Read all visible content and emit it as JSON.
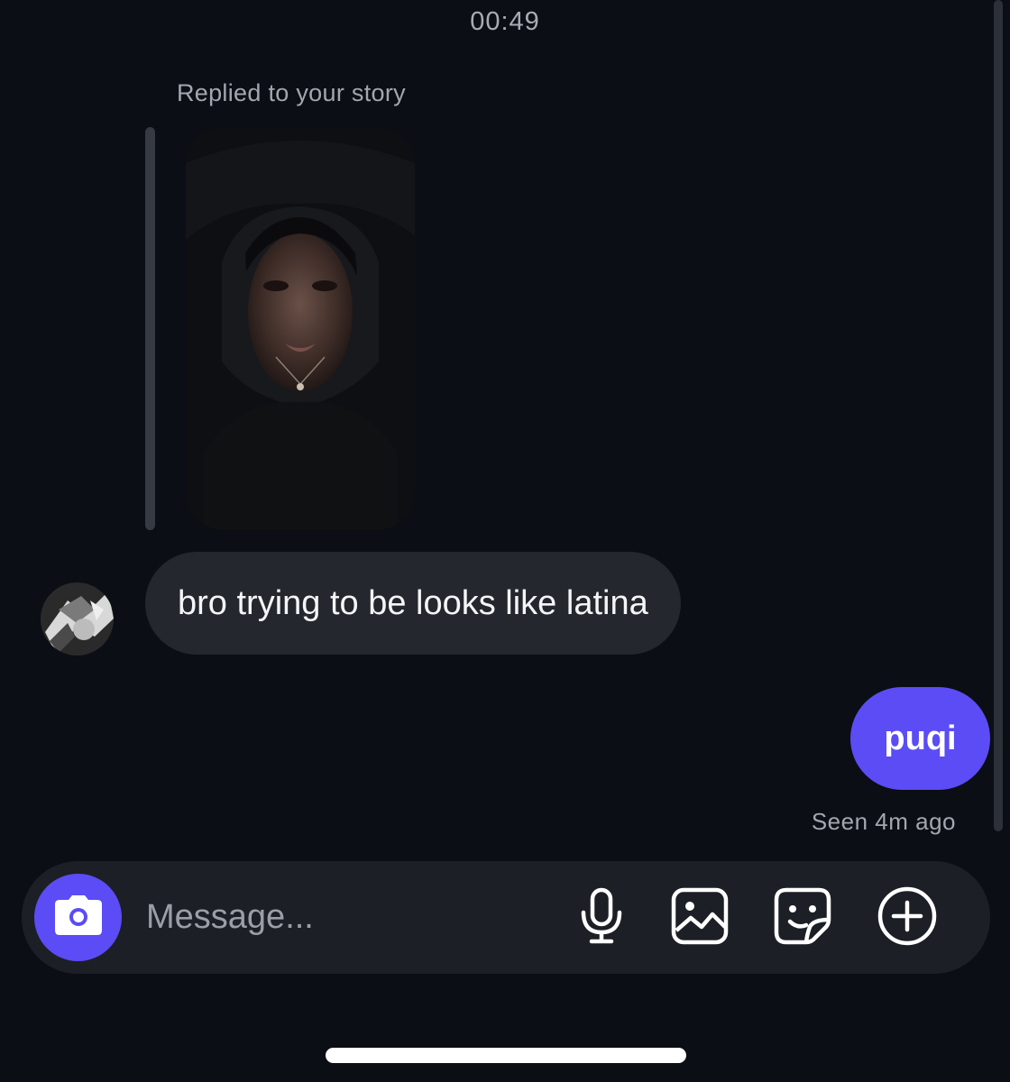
{
  "status": {
    "time": "00:49"
  },
  "story_reply": {
    "label": "Replied to your story"
  },
  "messages": [
    {
      "direction": "incoming",
      "text": "bro trying to be looks like latina"
    },
    {
      "direction": "outgoing",
      "text": "puqi"
    }
  ],
  "receipt": {
    "seen_text": "Seen 4m ago"
  },
  "composer": {
    "placeholder": "Message...",
    "buttons": [
      "camera-icon",
      "microphone-icon",
      "gallery-icon",
      "sticker-icon",
      "plus-icon"
    ]
  },
  "colors": {
    "background": "#0b0e14",
    "incoming_bubble": "#24272e",
    "outgoing_bubble": "#5b4cf5",
    "accent": "#5b4cf5",
    "composer_bg": "#1c1f25"
  }
}
